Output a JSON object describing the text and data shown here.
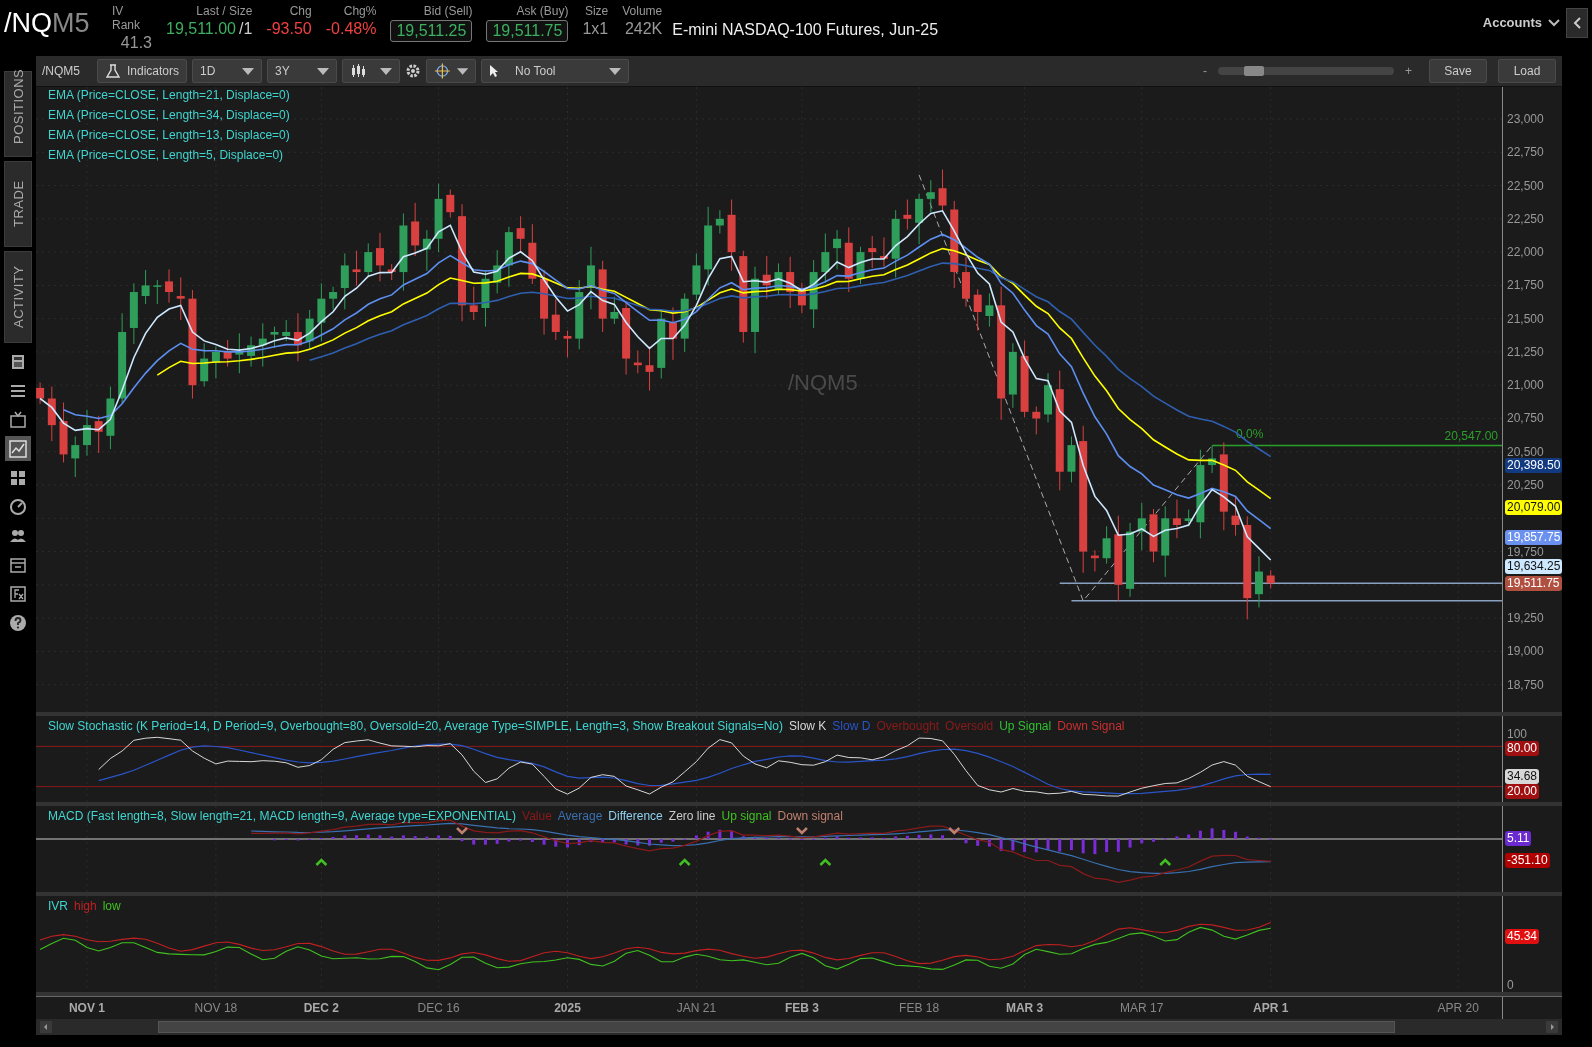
{
  "header": {
    "symbol": "/NQ",
    "symbol_suffix": "M5",
    "fields": [
      {
        "label": "IV Rank",
        "value": "41.3",
        "kind": "plain"
      },
      {
        "label": "Last / Size",
        "value": "19,511.00",
        "size": "/1",
        "kind": "up"
      },
      {
        "label": "Chg",
        "value": "-93.50",
        "kind": "down"
      },
      {
        "label": "Chg%",
        "value": "-0.48%",
        "kind": "down"
      },
      {
        "label": "Bid (Sell)",
        "value": "19,511.25",
        "kind": "boxed"
      },
      {
        "label": "Ask (Buy)",
        "value": "19,511.75",
        "kind": "boxed"
      },
      {
        "label": "Size",
        "value": "1x1",
        "kind": "plain"
      },
      {
        "label": "Volume",
        "value": "242K",
        "kind": "plain"
      }
    ],
    "description": "E-mini NASDAQ-100 Futures, Jun-25",
    "accounts": "Accounts"
  },
  "sidebar": {
    "tabs": [
      {
        "label": "POSITIONS",
        "selected": false
      },
      {
        "label": "TRADE",
        "selected": false
      },
      {
        "label": "ACTIVITY",
        "selected": false
      }
    ],
    "tools": [
      {
        "kind": "calculator",
        "selected": false
      },
      {
        "kind": "list",
        "selected": false
      },
      {
        "kind": "tv",
        "selected": false
      },
      {
        "kind": "chart",
        "selected": true
      },
      {
        "kind": "grid",
        "selected": false
      },
      {
        "kind": "gauge",
        "selected": false
      },
      {
        "kind": "people",
        "selected": false
      },
      {
        "kind": "calendar",
        "selected": false
      },
      {
        "kind": "fx",
        "selected": false
      },
      {
        "kind": "help",
        "selected": false
      }
    ]
  },
  "toolbar": {
    "symbol": "/NQM5",
    "indicators": "Indicators",
    "aggregation": "1D",
    "range": "3Y",
    "drawing_tool": "No Tool",
    "zoom_out": "-",
    "zoom_in": "+",
    "zoom": {
      "level": 0.15
    },
    "save": "Save",
    "load": "Load"
  },
  "price_chart": {
    "watermark": "/NQM5",
    "studies": [
      {
        "label": "EMA (Price=CLOSE, Length=21, Displace=0)",
        "color": "#ffff00"
      },
      {
        "label": "EMA (Price=CLOSE, Length=34, Displace=0)",
        "color": "#2f5fb0"
      },
      {
        "label": "EMA (Price=CLOSE, Length=13, Displace=0)",
        "color": "#5d8ff0"
      },
      {
        "label": "EMA (Price=CLOSE, Length=5, Displace=0)",
        "color": "#cde8ff"
      }
    ],
    "fib_ratio": "0.0%",
    "fib_price": "20,547.00",
    "y_axis": [
      "23,000",
      "22,750",
      "22,500",
      "22,250",
      "22,000",
      "21,750",
      "21,500",
      "21,250",
      "21,000",
      "20,750",
      "20,500",
      "20,250",
      "19,750",
      "19,250",
      "19,000",
      "18,750"
    ],
    "badges": [
      {
        "kind": "ema34",
        "text": "20,398.50",
        "color": "#123a80"
      },
      {
        "kind": "ema21",
        "text": "20,079.00",
        "color": "#ffff00"
      },
      {
        "kind": "ema13",
        "text": "19,857.75",
        "color": "#6a90f0"
      },
      {
        "kind": "ema5",
        "text": "19,634.25",
        "color": "#cde8ff"
      },
      {
        "kind": "last",
        "text": "19,511.75",
        "color": "#b05040"
      }
    ],
    "dates": [
      {
        "label": "NOV 1",
        "major": true
      },
      {
        "label": "NOV 18",
        "major": false
      },
      {
        "label": "DEC 2",
        "major": true
      },
      {
        "label": "DEC 16",
        "major": false
      },
      {
        "label": "2025",
        "major": true
      },
      {
        "label": "JAN 21",
        "major": false
      },
      {
        "label": "FEB 3",
        "major": true
      },
      {
        "label": "FEB 18",
        "major": false
      },
      {
        "label": "MAR 3",
        "major": true
      },
      {
        "label": "MAR 17",
        "major": false
      },
      {
        "label": "APR 1",
        "major": true
      },
      {
        "label": "APR 20",
        "major": false
      }
    ]
  },
  "stochastic": {
    "legend": "Slow Stochastic (K Period=14, D Period=9, Overbought=80, Oversold=20, Average Type=SIMPLE, Length=3, Show Breakout Signals=No)",
    "series_labels": [
      {
        "text": "Slow K",
        "color": "#d8d8d8"
      },
      {
        "text": "Slow D",
        "color": "#2a55c8"
      },
      {
        "text": "Overbought",
        "color": "#8b1a1a"
      },
      {
        "text": "Oversold",
        "color": "#8b1a1a"
      },
      {
        "text": "Up Signal",
        "color": "#30c030"
      },
      {
        "text": "Down Signal",
        "color": "#c83030"
      }
    ],
    "axis_labels": [
      {
        "kind": "top",
        "text": "100"
      },
      {
        "kind": "overbought",
        "text": "80.00",
        "color": "#a01010"
      },
      {
        "kind": "slow_k",
        "text": "34.68",
        "color": "#d8d8d8"
      },
      {
        "kind": "oversold",
        "text": "20.00",
        "color": "#a01010"
      }
    ]
  },
  "macd": {
    "legend": "MACD (Fast length=8, Slow length=21, MACD length=9, Average type=EXPONENTIAL)",
    "series_labels": [
      {
        "text": "Value",
        "color": "#8b1a1a"
      },
      {
        "text": "Average",
        "color": "#3a6fb0"
      },
      {
        "text": "Difference",
        "color": "#8fd0f0"
      },
      {
        "text": "Zero line",
        "color": "#cccccc"
      },
      {
        "text": "Up signal",
        "color": "#40c020"
      },
      {
        "text": "Down signal",
        "color": "#c08070"
      }
    ],
    "axis_labels": [
      {
        "kind": "difference",
        "text": "5.11",
        "color": "#6a2ad0"
      },
      {
        "kind": "value",
        "text": "-351.10",
        "color": "#b00000"
      }
    ]
  },
  "ivr": {
    "legend": "IVR",
    "series_labels": [
      {
        "text": "high",
        "color": "#c02020"
      },
      {
        "text": "low",
        "color": "#40c020"
      }
    ],
    "axis_labels": [
      {
        "kind": "high",
        "text": "45.34",
        "color": "#e01010"
      },
      {
        "kind": "zero",
        "text": "0"
      }
    ]
  }
}
